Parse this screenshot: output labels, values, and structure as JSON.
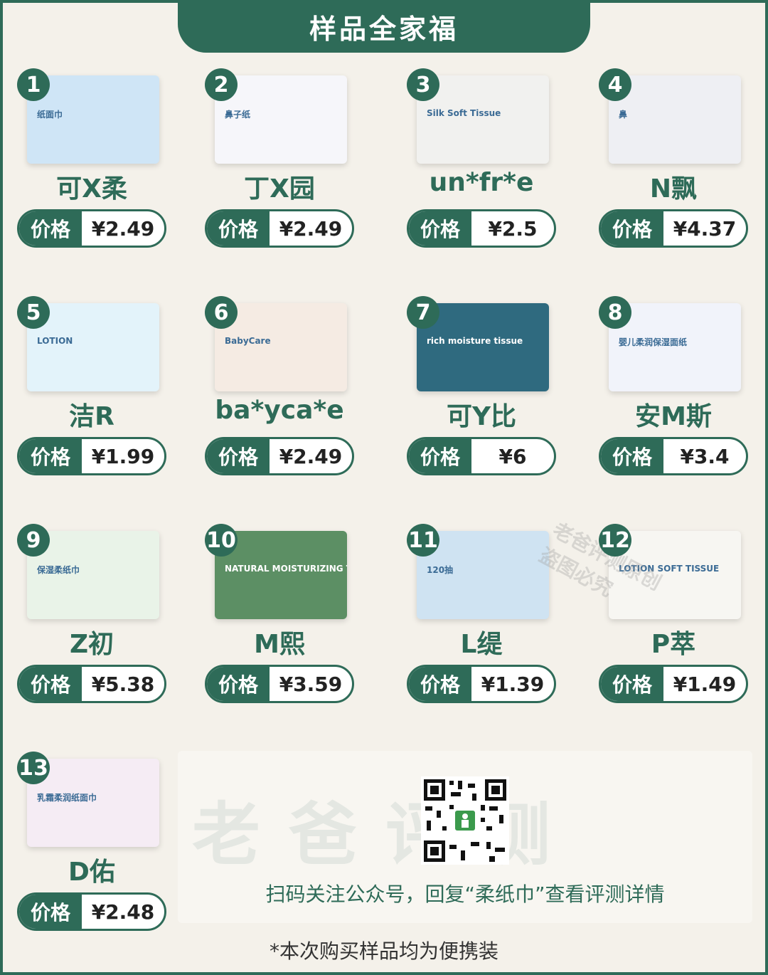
{
  "header": {
    "title": "样品全家福"
  },
  "products": [
    {
      "num": "1",
      "name": "可X柔",
      "price_label": "价格",
      "price": "¥2.49",
      "pack_color": "#cfe5f6",
      "pack_text": "纸面巾"
    },
    {
      "num": "2",
      "name": "丁X园",
      "price_label": "价格",
      "price": "¥2.49",
      "pack_color": "#f6f6fa",
      "pack_text": "鼻子纸"
    },
    {
      "num": "3",
      "name": "un*fr*e",
      "price_label": "价格",
      "price": "¥2.5",
      "pack_color": "#f1f1ef",
      "pack_text": "Silk Soft Tissue"
    },
    {
      "num": "4",
      "name": "N飘",
      "price_label": "价格",
      "price": "¥4.37",
      "pack_color": "#eeeff3",
      "pack_text": "鼻"
    },
    {
      "num": "5",
      "name": "洁R",
      "price_label": "价格",
      "price": "¥1.99",
      "pack_color": "#e3f3fa",
      "pack_text": "LOTION"
    },
    {
      "num": "6",
      "name": "ba*yca*e",
      "price_label": "价格",
      "price": "¥2.49",
      "pack_color": "#f5ebe3",
      "pack_text": "BabyCare"
    },
    {
      "num": "7",
      "name": "可Y比",
      "price_label": "价格",
      "price": "¥6",
      "pack_color": "#2f6a7f",
      "pack_text": "rich moisture tissue"
    },
    {
      "num": "8",
      "name": "安M斯",
      "price_label": "价格",
      "price": "¥3.4",
      "pack_color": "#f1f3fa",
      "pack_text": "婴儿柔润保湿面纸"
    },
    {
      "num": "9",
      "name": "Z初",
      "price_label": "价格",
      "price": "¥5.38",
      "pack_color": "#e9f3e8",
      "pack_text": "保湿柔纸巾"
    },
    {
      "num": "10",
      "name": "M熙",
      "price_label": "价格",
      "price": "¥3.59",
      "pack_color": "#5c8f64",
      "pack_text": "NATURAL MOISTURIZING TISSUE"
    },
    {
      "num": "11",
      "name": "L缇",
      "price_label": "价格",
      "price": "¥1.39",
      "pack_color": "#cfe3f2",
      "pack_text": "120抽"
    },
    {
      "num": "12",
      "name": "P萃",
      "price_label": "价格",
      "price": "¥1.49",
      "pack_color": "#f7f6f2",
      "pack_text": "LOTION SOFT TISSUE"
    },
    {
      "num": "13",
      "name": "D佑",
      "price_label": "价格",
      "price": "¥2.48",
      "pack_color": "#f5ecf4",
      "pack_text": "乳霜柔润纸面巾"
    }
  ],
  "promo": {
    "watermark": "老爸评测",
    "text": "扫码关注公众号，回复“柔纸巾”查看评测详情"
  },
  "stamp": {
    "line1": "老爸评测原创",
    "line2": "盗图必究"
  },
  "footnote": "*本次购买样品均为便携装",
  "colors": {
    "primary": "#2e6b58",
    "background": "#f4f1ea"
  }
}
